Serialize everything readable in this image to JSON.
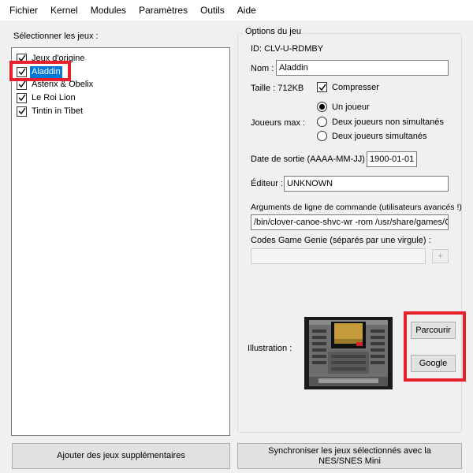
{
  "menu": [
    "Fichier",
    "Kernel",
    "Modules",
    "Paramètres",
    "Outils",
    "Aide"
  ],
  "games_list": {
    "label": "Sélectionner les jeux :",
    "items": [
      {
        "label": "Jeux d'origine",
        "checked": true,
        "selected": false
      },
      {
        "label": "Aladdin",
        "checked": true,
        "selected": true
      },
      {
        "label": "Asterix & Obelix",
        "checked": true,
        "selected": false
      },
      {
        "label": "Le Roi Lion",
        "checked": true,
        "selected": false
      },
      {
        "label": "Tintin in Tibet",
        "checked": true,
        "selected": false
      }
    ]
  },
  "options": {
    "group_title": "Options du jeu",
    "id_text": "ID: CLV-U-RDMBY",
    "name_label": "Nom :",
    "name_value": "Aladdin",
    "size_text": "Taille : 712KB",
    "compress_label": "Compresser",
    "compress_checked": true,
    "players_label": "Joueurs max :",
    "players_options": [
      "Un joueur",
      "Deux joueurs non simultanés",
      "Deux joueurs simultanés"
    ],
    "players_selected": 0,
    "release_label": "Date de sortie (AAAA-MM-JJ) :",
    "release_value": "1900-01-01",
    "publisher_label": "Éditeur :",
    "publisher_value": "UNKNOWN",
    "args_label": "Arguments de ligne de commande (utilisateurs avancés !)",
    "args_value": "/bin/clover-canoe-shvc-wr -rom /usr/share/games/C",
    "genie_label": "Codes Game Genie (séparés par une virgule) :",
    "genie_value": "",
    "genie_add": "+",
    "illustration_label": "Illustration :",
    "browse_button": "Parcourir",
    "google_button": "Google"
  },
  "buttons": {
    "add_games": "Ajouter des jeux supplémentaires",
    "sync": "Synchroniser les jeux sélectionnés avec la NES/SNES Mini"
  },
  "colors": {
    "highlight": "#e8202c",
    "selection": "#0078d7"
  }
}
